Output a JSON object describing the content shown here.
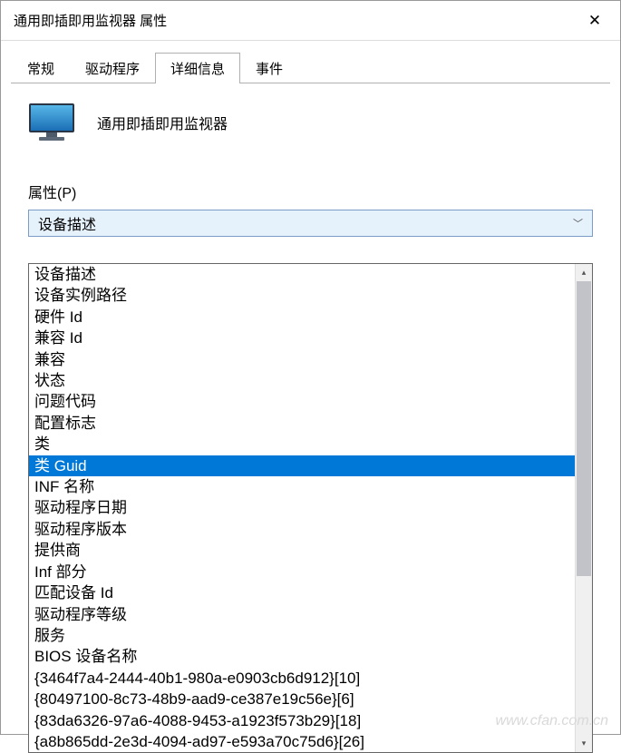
{
  "window": {
    "title": "通用即插即用监视器 属性"
  },
  "tabs": [
    {
      "label": "常规"
    },
    {
      "label": "驱动程序"
    },
    {
      "label": "详细信息"
    },
    {
      "label": "事件"
    }
  ],
  "device": {
    "name": "通用即插即用监视器"
  },
  "property_label": "属性(P)",
  "combo": {
    "selected": "设备描述"
  },
  "list": {
    "items": [
      {
        "label": "设备描述"
      },
      {
        "label": "设备实例路径"
      },
      {
        "label": "硬件 Id"
      },
      {
        "label": "兼容 Id"
      },
      {
        "label": "兼容"
      },
      {
        "label": "状态"
      },
      {
        "label": "问题代码"
      },
      {
        "label": "配置标志"
      },
      {
        "label": "类"
      },
      {
        "label": "类 Guid",
        "selected": true
      },
      {
        "label": "INF 名称"
      },
      {
        "label": "驱动程序日期"
      },
      {
        "label": "驱动程序版本"
      },
      {
        "label": "提供商"
      },
      {
        "label": "Inf 部分"
      },
      {
        "label": "匹配设备 Id"
      },
      {
        "label": "驱动程序等级"
      },
      {
        "label": "服务"
      },
      {
        "label": "BIOS 设备名称"
      },
      {
        "label": "{3464f7a4-2444-40b1-980a-e0903cb6d912}[10]"
      },
      {
        "label": "{80497100-8c73-48b9-aad9-ce387e19c56e}[6]"
      },
      {
        "label": "{83da6326-97a6-4088-9453-a1923f573b29}[18]"
      },
      {
        "label": "{a8b865dd-2e3d-4094-ad97-e593a70c75d6}[26]"
      }
    ]
  },
  "watermark": "www.cfan.com.cn"
}
